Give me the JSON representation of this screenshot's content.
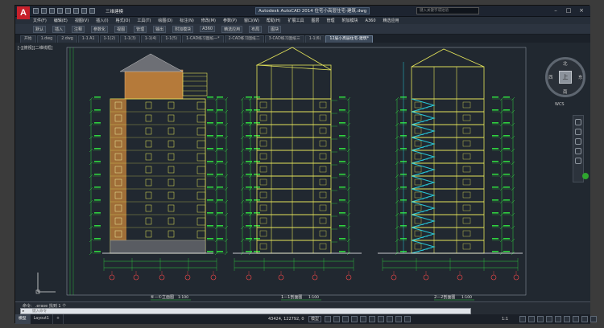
{
  "app": {
    "logo_letter": "A",
    "drawing_name": "三维建模",
    "window_title": "Autodesk AutoCAD 2014   住宅小高层住宅-建筑.dwg",
    "search_placeholder": "键入关键字或短语"
  },
  "menus": [
    "文件(F)",
    "编辑(E)",
    "视图(V)",
    "插入(I)",
    "格式(O)",
    "工具(T)",
    "绘图(D)",
    "标注(N)",
    "修改(M)",
    "参数(P)",
    "窗口(W)",
    "帮助(H)",
    "扩展工具",
    "图层",
    "管理",
    "附加模块",
    "A360",
    "精选应用"
  ],
  "ribbon": [
    "默认",
    "插入",
    "注释",
    "参数化",
    "视图",
    "管理",
    "输出",
    "附加模块",
    "A360",
    "精选应用",
    "布局",
    "图块"
  ],
  "tabs": [
    {
      "label": "开始",
      "active": false
    },
    {
      "label": "1.dwg",
      "active": false
    },
    {
      "label": "2.dwg",
      "active": false
    },
    {
      "label": "1-1 A1",
      "active": false
    },
    {
      "label": "1-1(2)",
      "active": false
    },
    {
      "label": "1-1(3)",
      "active": false
    },
    {
      "label": "1-1(4)",
      "active": false
    },
    {
      "label": "1-1(5)",
      "active": false
    },
    {
      "label": "1-CAD练习图纸一*",
      "active": false
    },
    {
      "label": "2-CAD练习图纸二",
      "active": false
    },
    {
      "label": "3-CAD练习图纸三",
      "active": false
    },
    {
      "label": "1-1(6)",
      "active": false
    },
    {
      "label": "12层小高层住宅-建筑*",
      "active": true
    }
  ],
  "viewport_label": "[-][俯视][二维线框]",
  "viewcube": {
    "top": "上",
    "north": "北",
    "south": "南",
    "east": "东",
    "west": "西",
    "wcs": "WCS"
  },
  "section_titles": [
    {
      "label": "⑥—①立面图",
      "scale": "1:100"
    },
    {
      "label": "1—1剖面图",
      "scale": "1:100"
    },
    {
      "label": "2—2剖面图",
      "scale": "1:100"
    }
  ],
  "command": {
    "history": "命令: _.erase 找到 1 个",
    "placeholder": "键入命令"
  },
  "layout_tabs": [
    {
      "label": "模型",
      "active": true
    },
    {
      "label": "Layout1",
      "active": false
    }
  ],
  "status": {
    "coords": "43424, 122792, 0",
    "model_label": "模型",
    "scale": "1:1"
  },
  "colors": {
    "background": "#212830",
    "building_line": "#e5e55a",
    "dimension": "#2fd23f",
    "roof": "#b57a3a",
    "stair": "#28c8d8",
    "axis_bubble": "#ff4a4a"
  }
}
